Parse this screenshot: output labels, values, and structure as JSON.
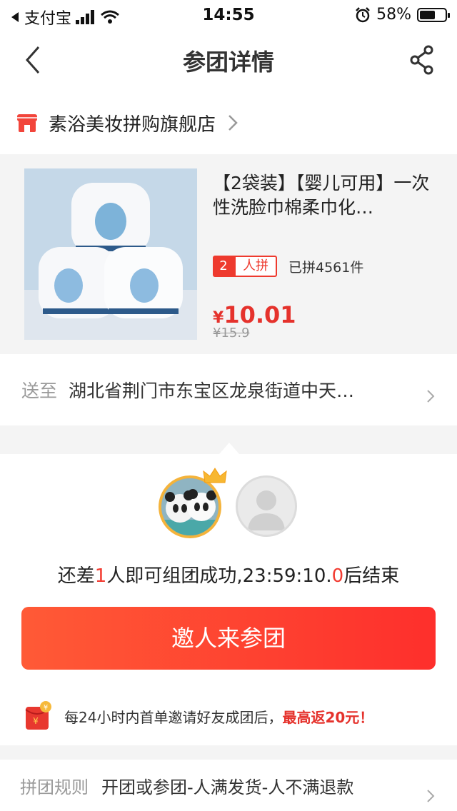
{
  "status_bar": {
    "carrier": "支付宝",
    "time": "14:55",
    "battery_percent": "58%",
    "battery_level": 0.58
  },
  "nav": {
    "title": "参团详情",
    "back_icon": "chevron-left-icon",
    "share_icon": "share-icon"
  },
  "store": {
    "name": "素浴美妆拼购旗舰店",
    "icon": "store-icon"
  },
  "product": {
    "title": "【2袋装】【婴儿可用】一次性洗脸巾棉柔巾化…",
    "group_size": "2",
    "group_label": "人拼",
    "sold": "已拼4561件",
    "currency": "¥",
    "price": "10.01",
    "original_price": "¥15.9"
  },
  "shipping": {
    "label": "送至",
    "address": "湖北省荆门市东宝区龙泉街道中天…"
  },
  "group": {
    "status_prefix": "还差",
    "missing_count": "1",
    "status_middle": "人即可组团成功,23:59:10.",
    "countdown_tenths": "0",
    "status_suffix": "后结束",
    "invite_button": "邀人来参团",
    "promo_text": "每24小时内首单邀请好友成团后，",
    "promo_highlight": "最高返20元！"
  },
  "rules": {
    "label": "拼团规则",
    "text": "开团或参团-人满发货-人不满退款"
  },
  "colors": {
    "accent": "#f23b31",
    "button_gradient_start": "#ff5a36",
    "button_gradient_end": "#fe2f2c",
    "host_ring": "#f4b33b"
  }
}
